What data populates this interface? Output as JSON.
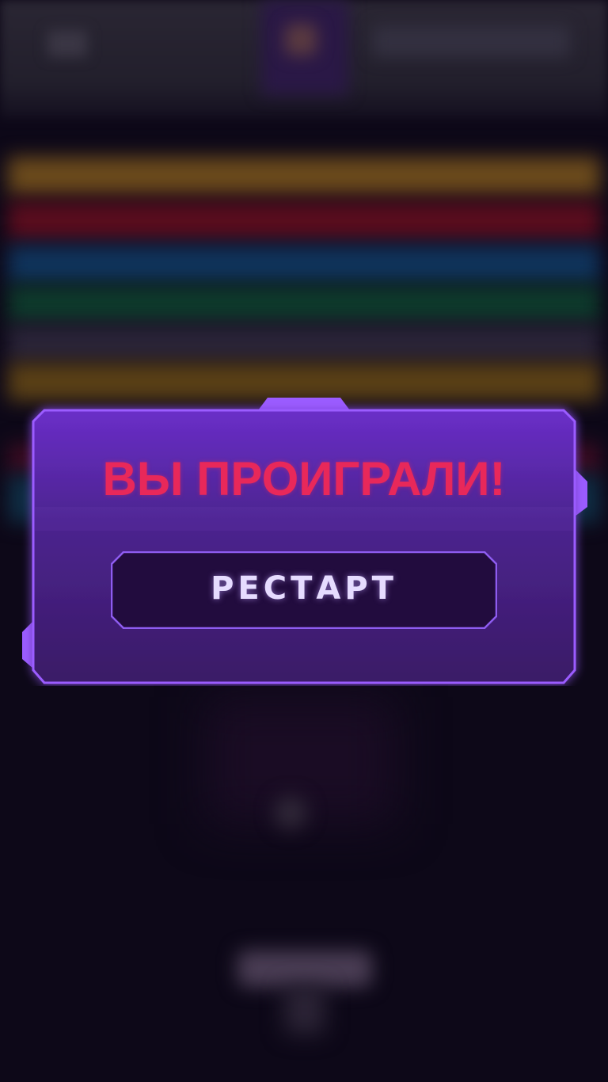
{
  "game_over": {
    "title": "ВЫ ПРОИГРАЛИ!",
    "restart_label": "РЕСТАРТ"
  },
  "colors": {
    "panel_top": "#6a2ec8",
    "panel_bottom": "#3a1a66",
    "panel_border": "#9b5cff",
    "title": "#e8285a",
    "button_fill": "#220c3e",
    "button_border": "#8e5cf0",
    "button_text": "#e6dcff",
    "background": "#0d0818"
  }
}
